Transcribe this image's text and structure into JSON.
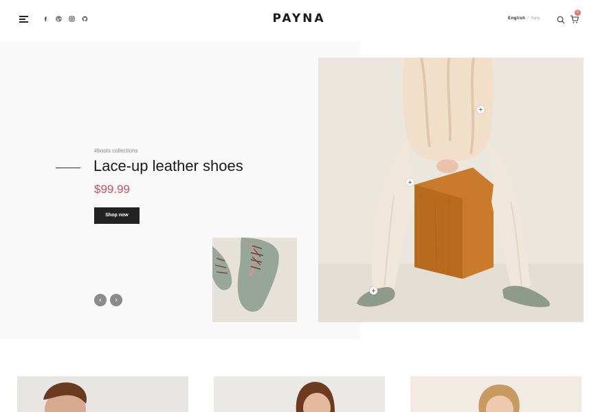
{
  "header": {
    "logo": "PAYNA",
    "menu_icon": "hamburger-icon",
    "social_icons": [
      "facebook-icon",
      "dribbble-icon",
      "instagram-icon",
      "github-icon"
    ],
    "language": {
      "active": "English",
      "separator": "/",
      "inactive": "Italy"
    },
    "search_icon": "search-icon",
    "cart_icon": "cart-icon",
    "cart_count": "0"
  },
  "hero": {
    "tag": "#boots collections",
    "title": "Lace-up leather shoes",
    "price": "$99.99",
    "button_label": "Shop now",
    "prev_icon": "chevron-left-icon",
    "next_icon": "chevron-right-icon",
    "hotspot_icon": "plus-icon",
    "hotspot_label": "+"
  },
  "colors": {
    "accent_price": "#c8505a",
    "button_bg": "#222222",
    "cart_badge": "#e07a6e"
  }
}
